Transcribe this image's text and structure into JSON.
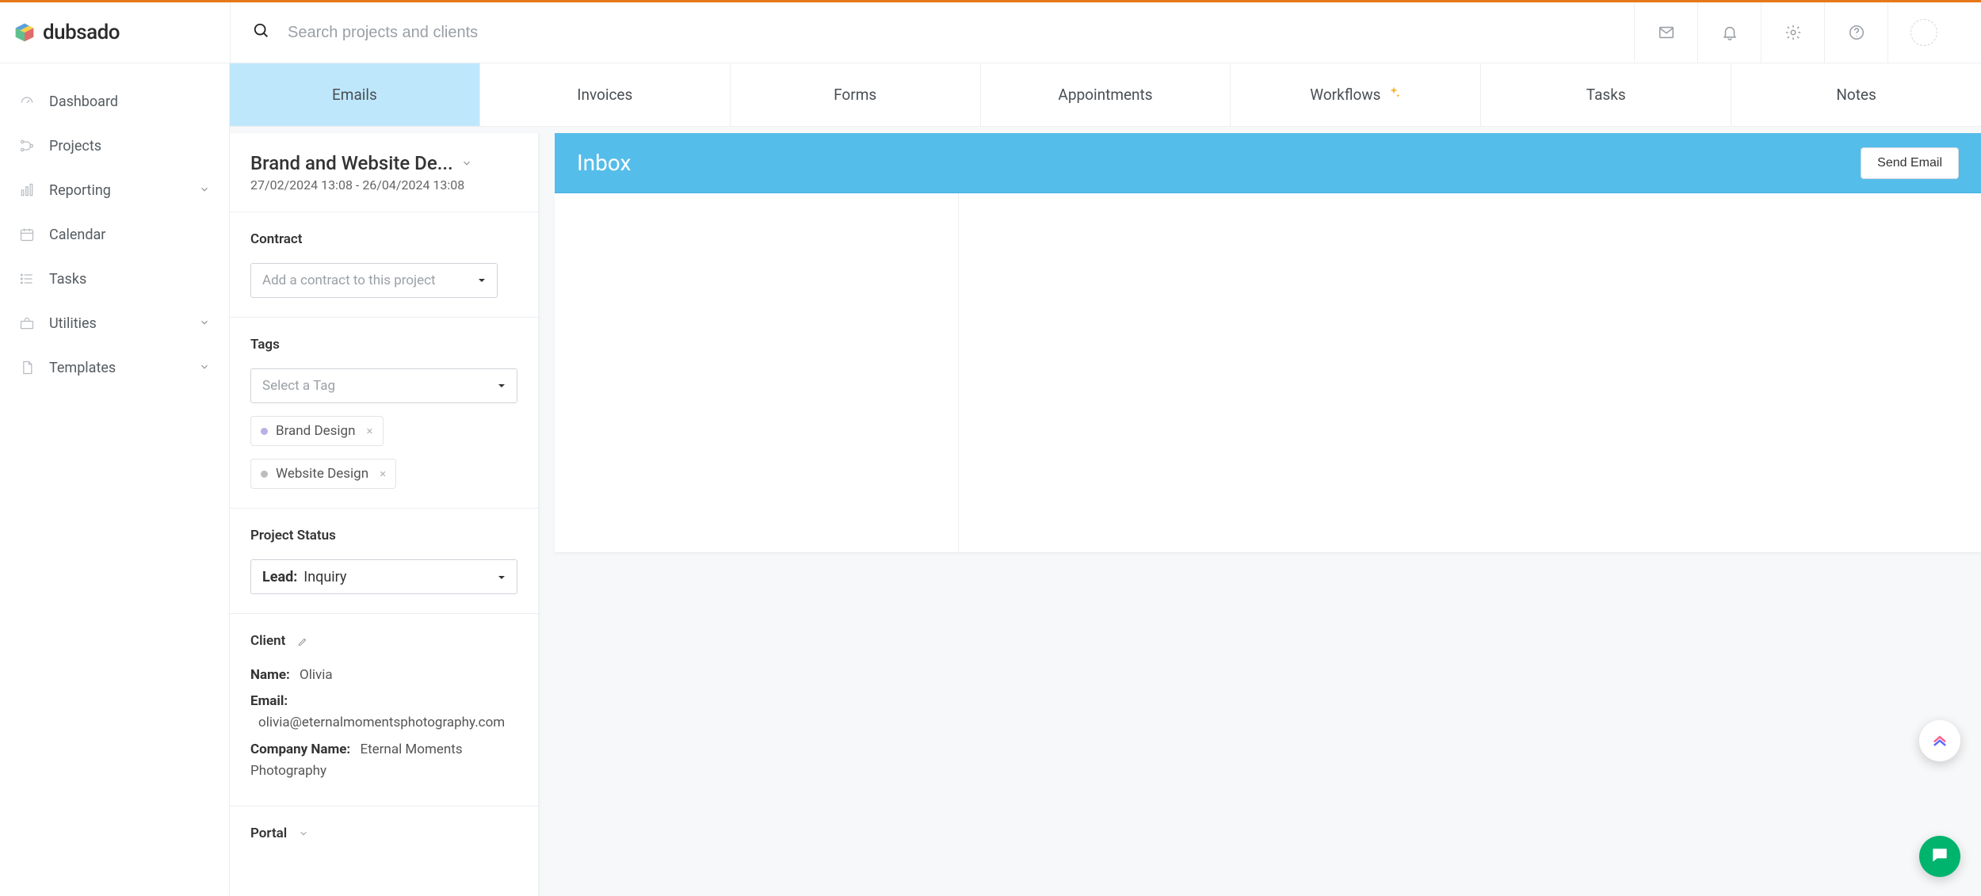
{
  "app_name": "dubsado",
  "search": {
    "placeholder": "Search projects and clients"
  },
  "sidebar": {
    "items": [
      {
        "label": "Dashboard",
        "expandable": false
      },
      {
        "label": "Projects",
        "expandable": false
      },
      {
        "label": "Reporting",
        "expandable": true
      },
      {
        "label": "Calendar",
        "expandable": false
      },
      {
        "label": "Tasks",
        "expandable": false
      },
      {
        "label": "Utilities",
        "expandable": true
      },
      {
        "label": "Templates",
        "expandable": true
      }
    ]
  },
  "tabs": [
    {
      "label": "Emails",
      "active": true
    },
    {
      "label": "Invoices",
      "active": false
    },
    {
      "label": "Forms",
      "active": false
    },
    {
      "label": "Appointments",
      "active": false
    },
    {
      "label": "Workflows",
      "active": false,
      "sparkle": true
    },
    {
      "label": "Tasks",
      "active": false
    },
    {
      "label": "Notes",
      "active": false
    }
  ],
  "project": {
    "title": "Brand and Website De...",
    "date_range": "27/02/2024 13:08 - 26/04/2024 13:08",
    "contract_heading": "Contract",
    "contract_placeholder": "Add a contract to this project",
    "tags_heading": "Tags",
    "tags_placeholder": "Select a Tag",
    "tags": [
      {
        "label": "Brand Design",
        "color": "purple"
      },
      {
        "label": "Website Design",
        "color": "grey"
      }
    ],
    "status_heading": "Project Status",
    "status_label": "Lead:",
    "status_value": "Inquiry",
    "client_heading": "Client",
    "client_name_label": "Name:",
    "client_name": "Olivia",
    "client_email_label": "Email:",
    "client_email": "olivia@eternalmomentsphotography.com",
    "client_company_label": "Company Name:",
    "client_company": "Eternal Moments Photography",
    "portal_heading": "Portal"
  },
  "inbox": {
    "title": "Inbox",
    "send_button": "Send Email"
  }
}
